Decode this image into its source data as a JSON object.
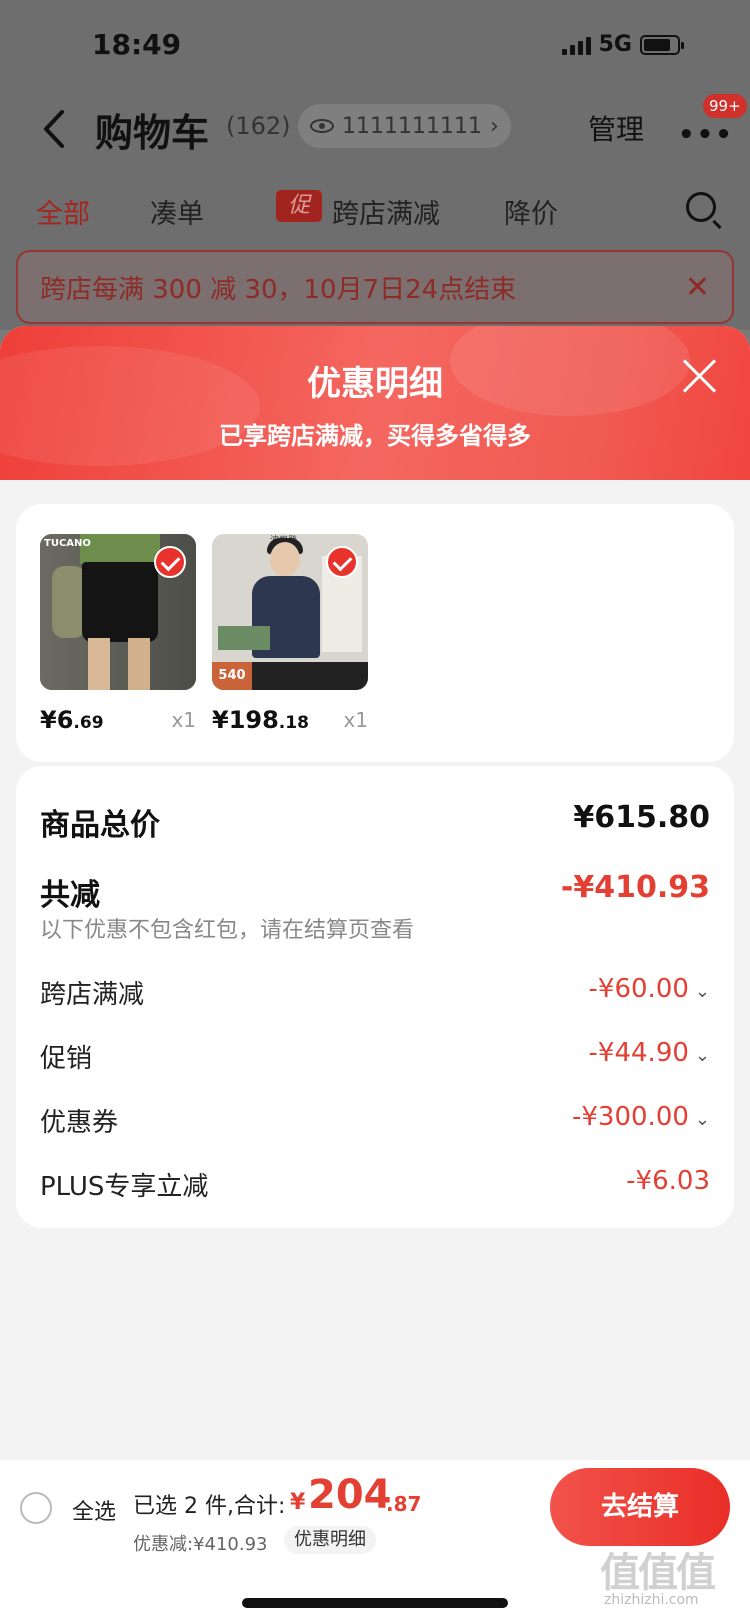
{
  "status": {
    "time": "18:49",
    "network": "5G"
  },
  "nav": {
    "title": "购物车",
    "count": "(162)",
    "address": "1111111111",
    "address_arrow": "›",
    "manage": "管理",
    "more": "•••",
    "badge": "99+"
  },
  "tabs": {
    "all": "全部",
    "bundle": "凑单",
    "promo_tag": "促",
    "cross_store": "跨店满减",
    "price_drop": "降价"
  },
  "notice": {
    "text": "跨店每满 300 减 30，10月7日24点结束",
    "close": "✕"
  },
  "sheet": {
    "title": "优惠明细",
    "subtitle": "已享跨店满减，买得多省得多"
  },
  "products": [
    {
      "price_int": "¥6",
      "price_dec": ".69",
      "qty": "x1",
      "logo": "TUCANO"
    },
    {
      "price_int": "¥198",
      "price_dec": ".18",
      "qty": "x1",
      "brand": "波司登",
      "tag": "540"
    }
  ],
  "summary": {
    "total_label": "商品总价",
    "total_value": "¥615.80",
    "reduce_label": "共减",
    "reduce_value": "-¥410.93",
    "note": "以下优惠不包含红包，请在结算页查看",
    "items": [
      {
        "label": "跨店满减",
        "value": "-¥60.00",
        "chev": "⌄"
      },
      {
        "label": "促销",
        "value": "-¥44.90",
        "chev": "⌄"
      },
      {
        "label": "优惠券",
        "value": "-¥300.00",
        "chev": "⌄"
      },
      {
        "label": "PLUS专享立减",
        "value": "-¥6.03"
      }
    ]
  },
  "bottom": {
    "select_all": "全选",
    "selected": "已选 2 件,合计:",
    "currency": "¥",
    "total_int": "204",
    "total_dec": ".87",
    "discount": "优惠减:¥410.93",
    "detail": "优惠明细",
    "checkout": "去结算"
  },
  "watermark": {
    "text": "值值值",
    "sub": "zhizhizhi.com"
  },
  "colors": {
    "accent": "#e33f33",
    "header": "#ee3f38"
  }
}
